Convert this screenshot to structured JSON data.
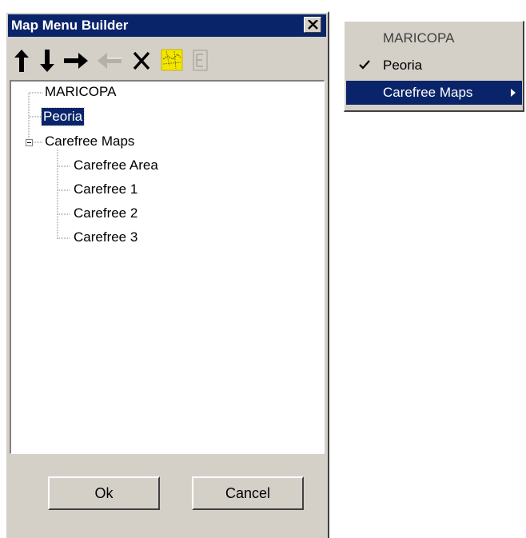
{
  "dialog": {
    "title": "Map Menu Builder",
    "toolbar": [
      {
        "name": "move-up",
        "icon": "arrow-up-icon",
        "enabled": true
      },
      {
        "name": "move-down",
        "icon": "arrow-down-icon",
        "enabled": true
      },
      {
        "name": "indent",
        "icon": "arrow-right-icon",
        "enabled": true
      },
      {
        "name": "outdent",
        "icon": "arrow-left-icon",
        "enabled": false
      },
      {
        "name": "delete",
        "icon": "delete-x-icon",
        "enabled": true
      },
      {
        "name": "map",
        "icon": "map-icon",
        "enabled": true
      },
      {
        "name": "properties",
        "icon": "properties-icon",
        "enabled": false
      }
    ],
    "tree": {
      "items": [
        {
          "label": "MARICOPA",
          "level": 0,
          "selected": false
        },
        {
          "label": "Peoria",
          "level": 0,
          "selected": true
        },
        {
          "label": "Carefree Maps",
          "level": 0,
          "expanded": true
        },
        {
          "label": "Carefree Area",
          "level": 1
        },
        {
          "label": "Carefree 1",
          "level": 1
        },
        {
          "label": "Carefree 2",
          "level": 1
        },
        {
          "label": "Carefree 3",
          "level": 1
        }
      ]
    },
    "ok_label": "Ok",
    "cancel_label": "Cancel"
  },
  "popup_menu": {
    "items": [
      {
        "label": "MARICOPA",
        "checked": false,
        "disabled": true
      },
      {
        "label": "Peoria",
        "checked": true
      },
      {
        "label": "Carefree Maps",
        "submenu": true,
        "highlighted": true
      }
    ]
  },
  "colors": {
    "titlebar": "#0a246a",
    "face": "#d4d0c8",
    "selection": "#0a246a",
    "disabled_text": "#808080"
  }
}
